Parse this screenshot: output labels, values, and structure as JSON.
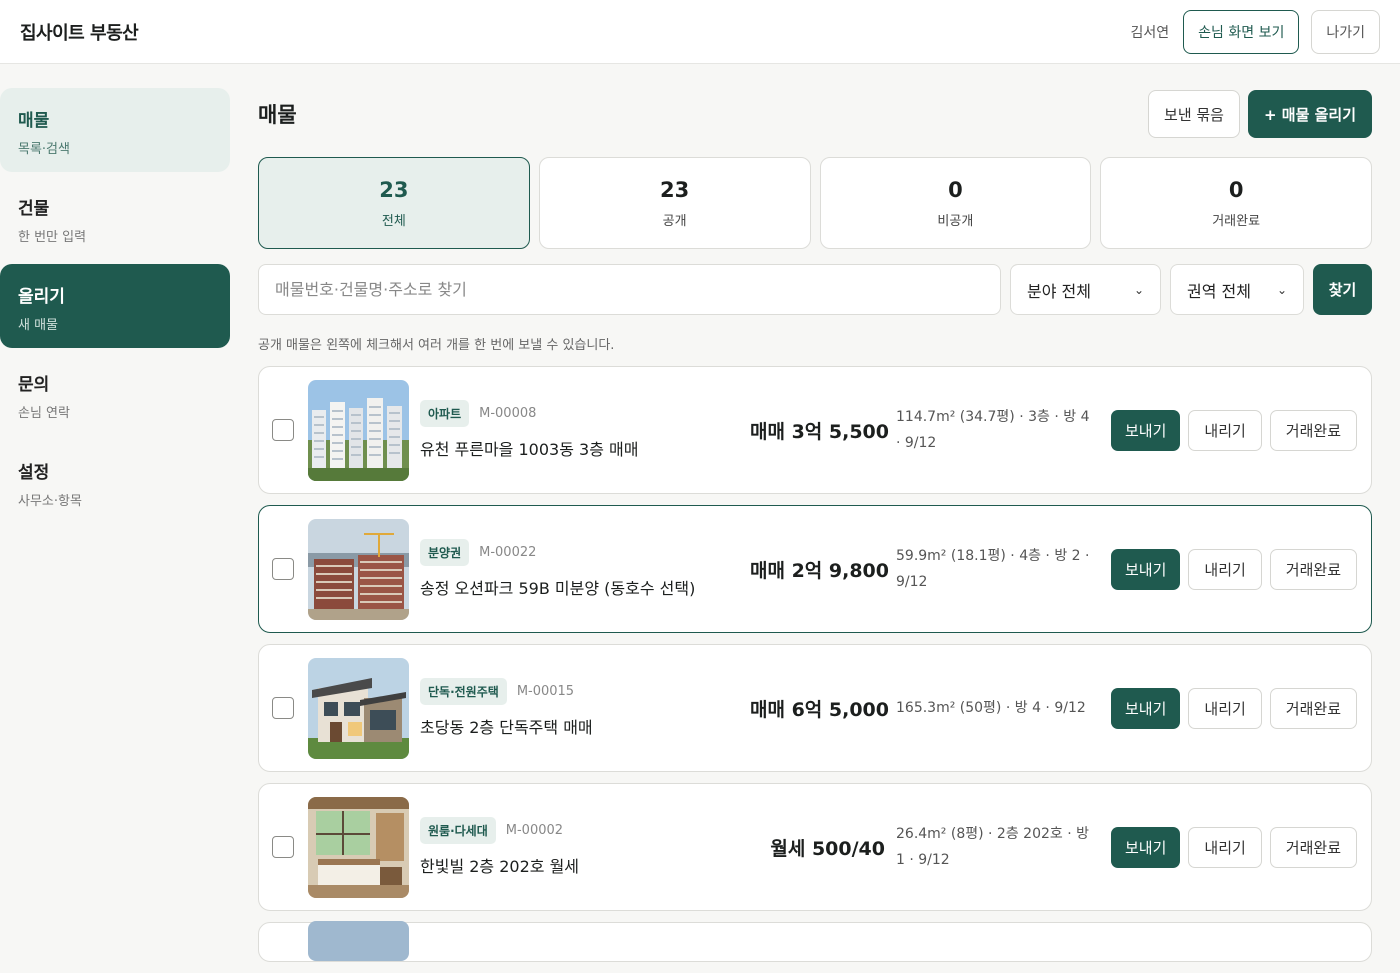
{
  "app": {
    "brand": "집사이트 부동산",
    "user_name": "김서연",
    "guest_view_label": "손님 화면 보기",
    "logout_label": "나가기"
  },
  "sidebar": {
    "items": [
      {
        "title": "매물",
        "sub": "목록·검색"
      },
      {
        "title": "건물",
        "sub": "한 번만 입력"
      },
      {
        "title": "올리기",
        "sub": "새 매물"
      },
      {
        "title": "문의",
        "sub": "손님 연락"
      },
      {
        "title": "설정",
        "sub": "사무소·항목"
      }
    ]
  },
  "main": {
    "title": "매물",
    "sent_bundle_label": "보낸 묶음",
    "add_label": "+ 매물 올리기",
    "stats": [
      {
        "count": "23",
        "label": "전체"
      },
      {
        "count": "23",
        "label": "공개"
      },
      {
        "count": "0",
        "label": "비공개"
      },
      {
        "count": "0",
        "label": "거래완료"
      }
    ],
    "search": {
      "placeholder": "매물번호·건물명·주소로 찾기",
      "field_select": "분야 전체",
      "region_select": "권역 전체",
      "button": "찾기"
    },
    "hint": "공개 매물은 왼쪽에 체크해서 여러 개를 한 번에 보낼 수 있습니다.",
    "actions": {
      "send": "보내기",
      "unpublish": "내리기",
      "complete": "거래완료"
    },
    "listings": [
      {
        "type": "아파트",
        "code": "M-00008",
        "title": "유천 푸른마을 1003동 3층 매매",
        "price": "매매 3억 5,500",
        "spec": "114.7m² (34.7평) · 3층 · 방 4 · 9/12"
      },
      {
        "type": "분양권",
        "code": "M-00022",
        "title": "송정 오션파크 59B 미분양 (동호수 선택)",
        "price": "매매 2억 9,800",
        "spec": "59.9m² (18.1평) · 4층 · 방 2 · 9/12"
      },
      {
        "type": "단독·전원주택",
        "code": "M-00015",
        "title": "초당동 2층 단독주택 매매",
        "price": "매매 6억 5,000",
        "spec": "165.3m² (50평) · 방 4 · 9/12"
      },
      {
        "type": "원룸·다세대",
        "code": "M-00002",
        "title": "한빛빌 2층 202호 월세",
        "price": "월세 500/40",
        "spec": "26.4m² (8평) · 2층 202호 · 방 1 · 9/12"
      }
    ]
  },
  "colors": {
    "accent": "#1f5a4f",
    "accent_soft": "#e7efec"
  }
}
